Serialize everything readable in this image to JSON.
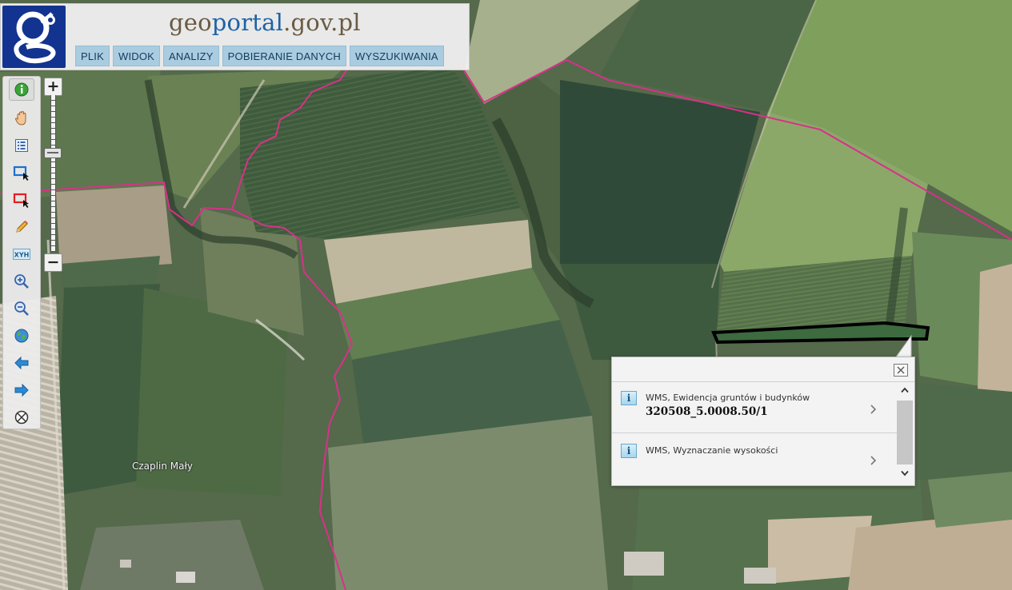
{
  "header": {
    "title_part1": "geo",
    "title_part2": "portal",
    "title_part3": ".gov.pl"
  },
  "menu": [
    "PLIK",
    "WIDOK",
    "ANALIZY",
    "POBIERANIE DANYCH",
    "WYSZUKIWANIA"
  ],
  "toolbar": {
    "tools": [
      {
        "icon": "info-icon",
        "active": true
      },
      {
        "icon": "hand-pan-icon"
      },
      {
        "icon": "legend-list-icon"
      },
      {
        "icon": "select-rectangle-icon"
      },
      {
        "icon": "select-rectangle-red-icon"
      },
      {
        "icon": "pencil-icon"
      },
      {
        "icon": "xyh-coordinates-icon",
        "text": "XYH"
      },
      {
        "icon": "zoom-in-icon"
      },
      {
        "icon": "zoom-out-icon"
      },
      {
        "icon": "globe-icon"
      },
      {
        "icon": "arrow-back-icon"
      },
      {
        "icon": "arrow-forward-icon"
      },
      {
        "icon": "no-tool-icon"
      }
    ]
  },
  "zoom": {
    "in_label": "+",
    "out_label": "−"
  },
  "map": {
    "place_label": "Czaplin Mały"
  },
  "popup": {
    "rows": [
      {
        "label": "WMS, Ewidencja gruntów i budynków",
        "value": "320508_5.0008.50/1"
      },
      {
        "label": "WMS, Wyznaczanie wysokości",
        "value": ""
      }
    ]
  },
  "colors": {
    "boundary_line": "#d8318a",
    "parcel_outline": "#000000",
    "menu_bg": "#a9cce1",
    "logo_bg": "#12338f"
  }
}
